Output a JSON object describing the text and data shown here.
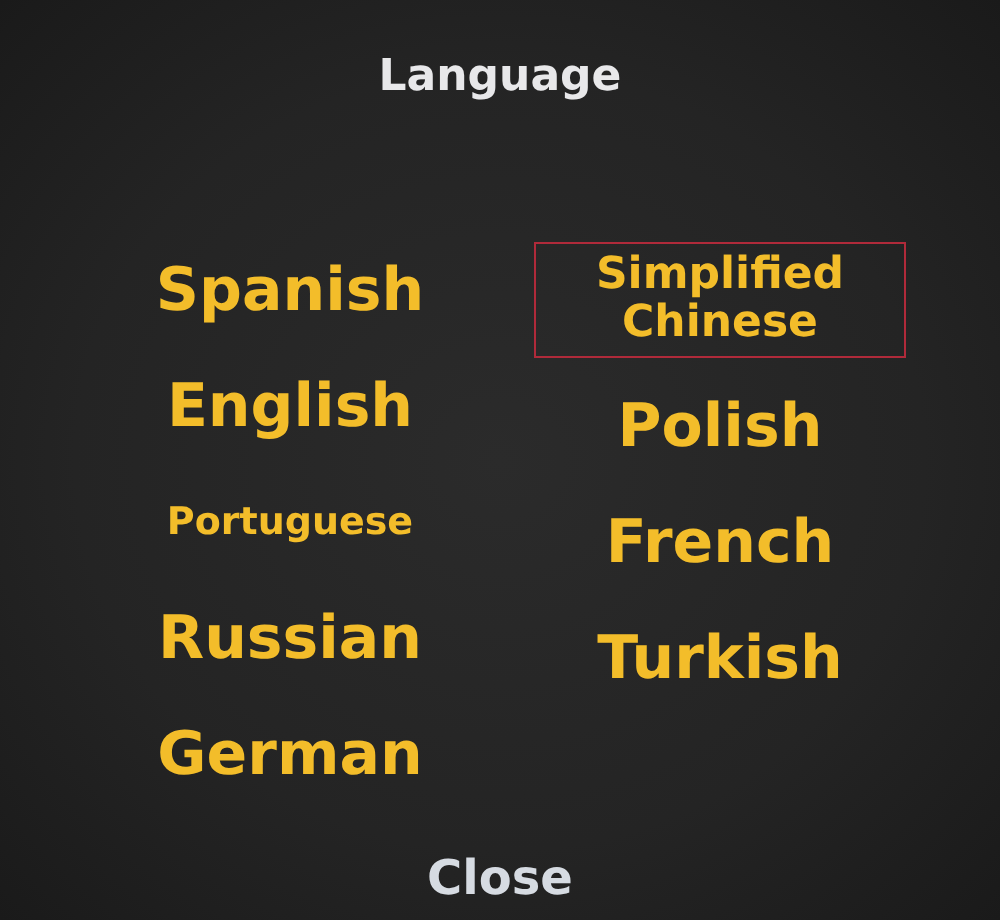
{
  "title": "Language",
  "columns": [
    [
      {
        "label": "Spanish",
        "selected": false
      },
      {
        "label": "English",
        "selected": false
      },
      {
        "label": "Portuguese",
        "selected": false
      },
      {
        "label": "Russian",
        "selected": false
      },
      {
        "label": "German",
        "selected": false
      }
    ],
    [
      {
        "label": "Simplified Chinese",
        "selected": true
      },
      {
        "label": "Polish",
        "selected": false
      },
      {
        "label": "French",
        "selected": false
      },
      {
        "label": "Turkish",
        "selected": false
      }
    ]
  ],
  "close": "Close"
}
